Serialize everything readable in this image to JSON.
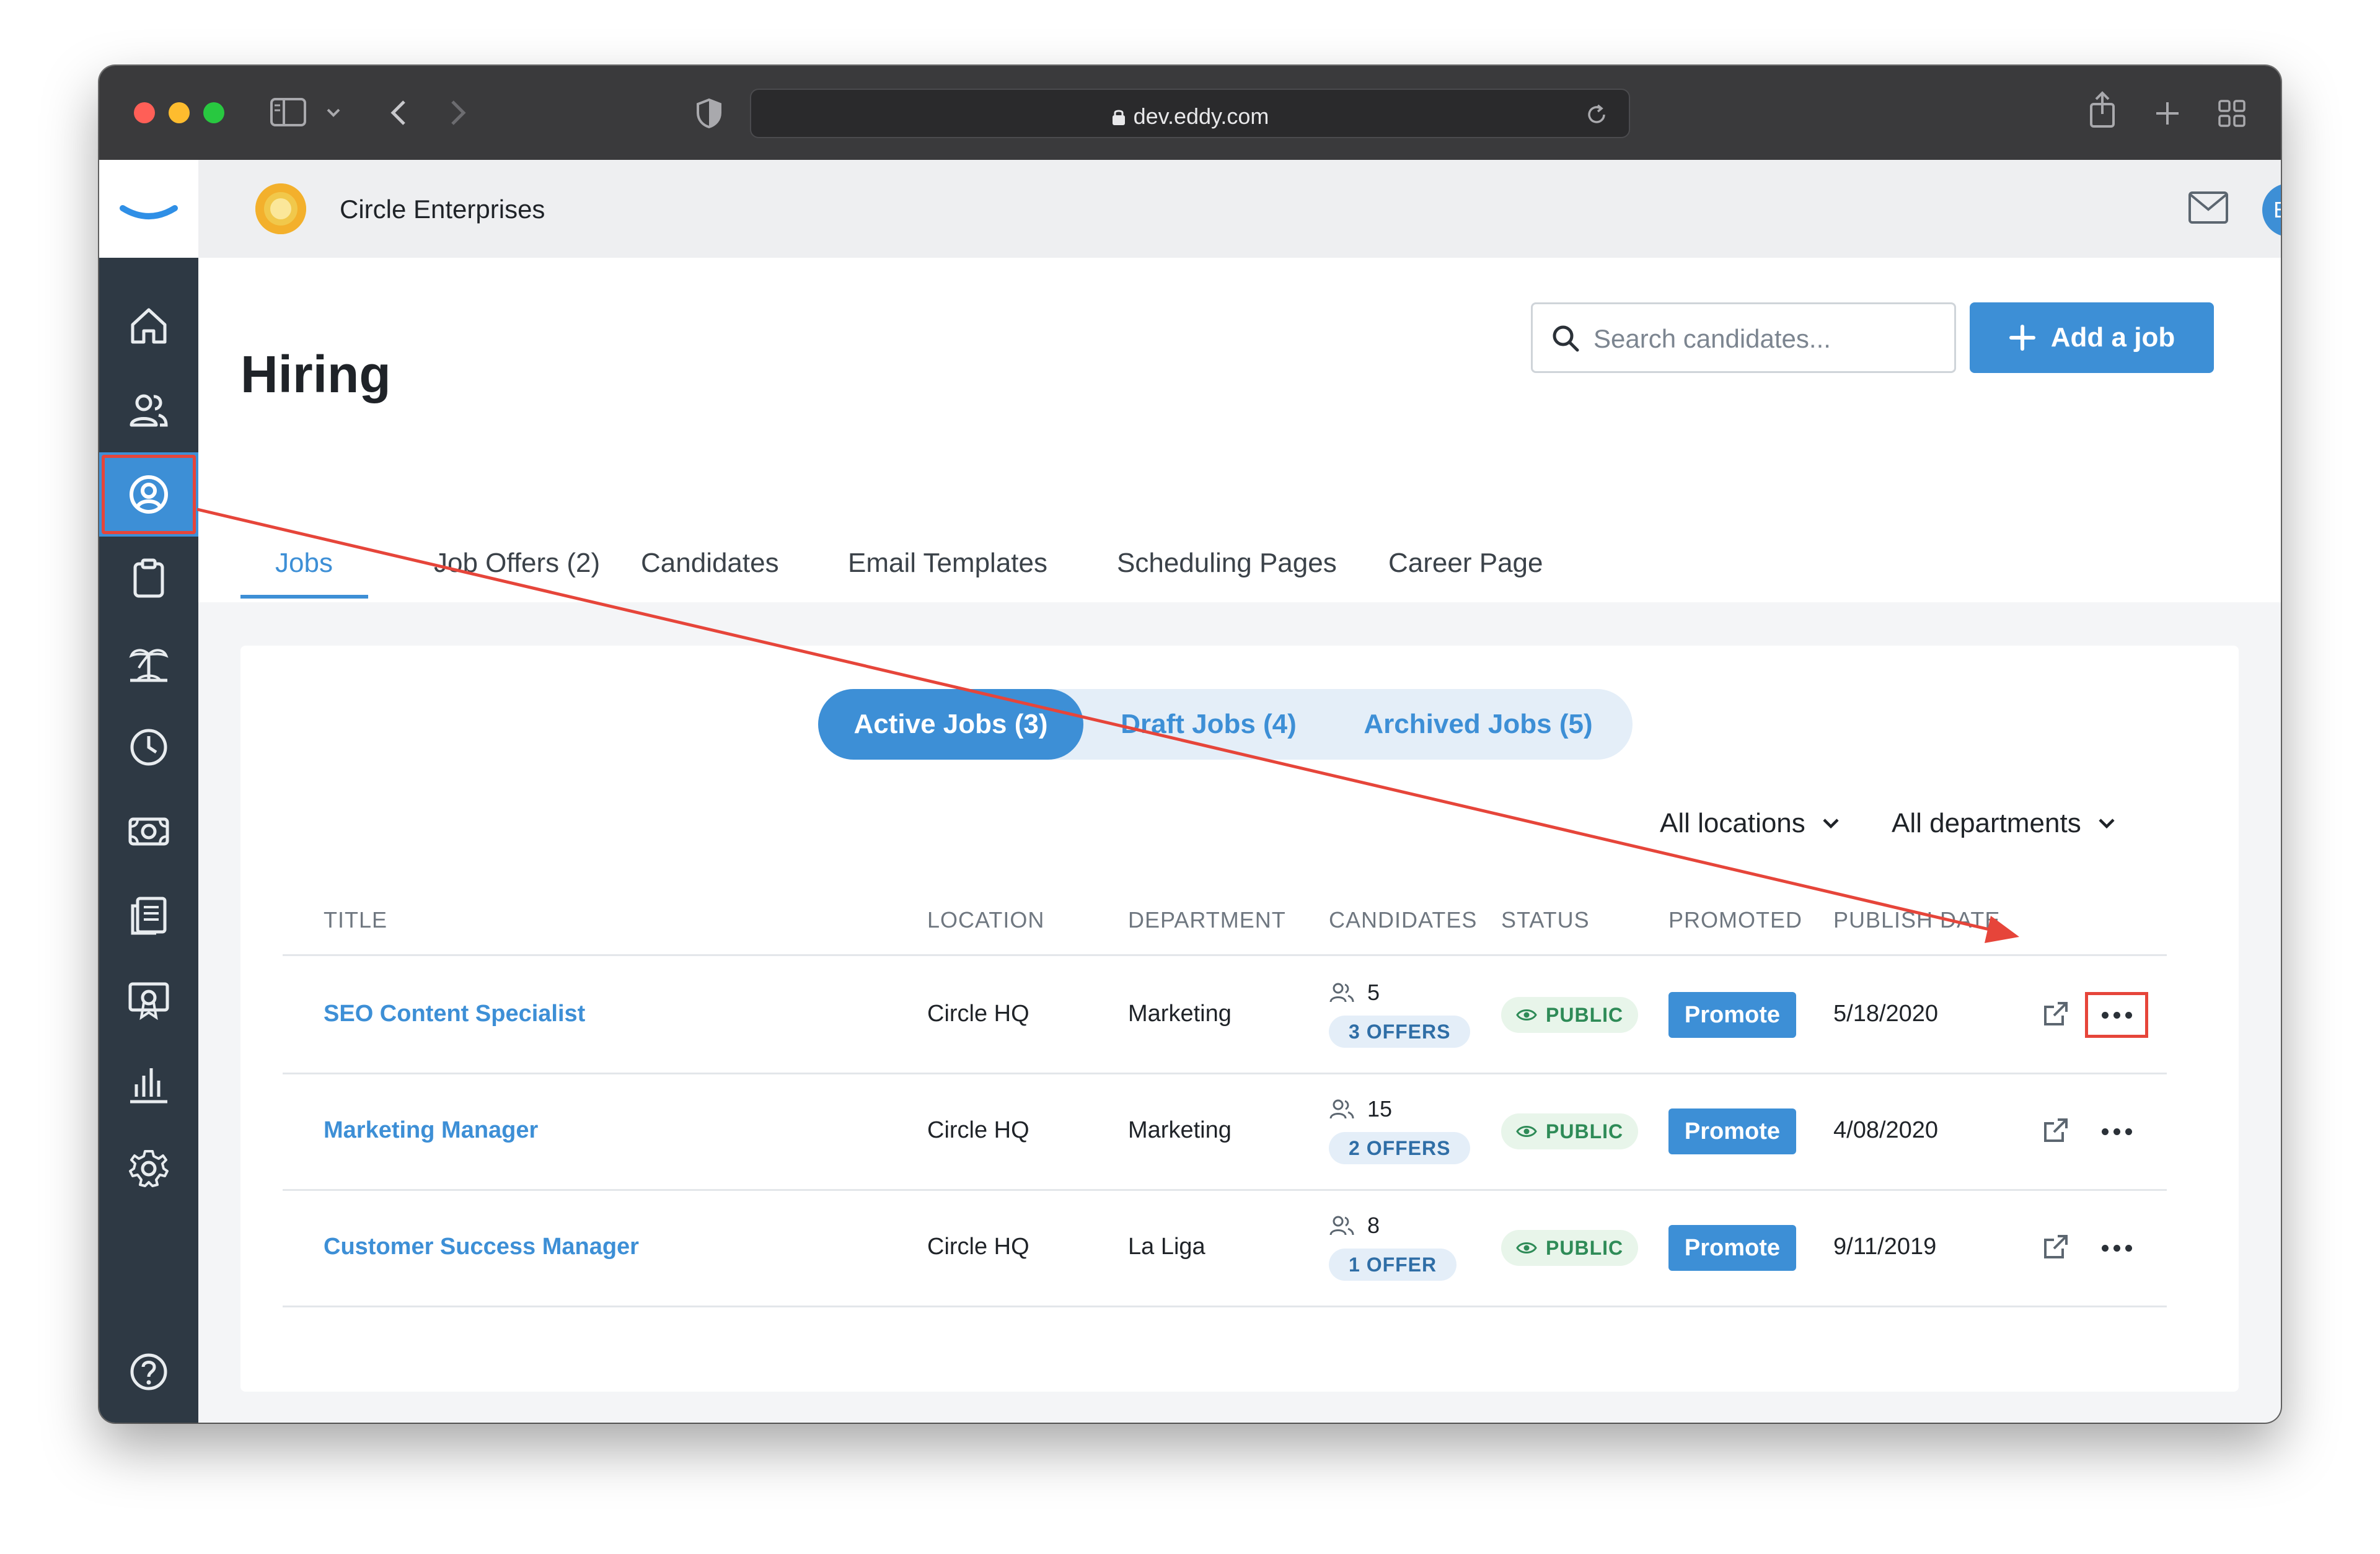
{
  "browser": {
    "url": "dev.eddy.com"
  },
  "header": {
    "company_name": "Circle Enterprises",
    "avatar_initials": "EN"
  },
  "page": {
    "title": "Hiring",
    "search_placeholder": "Search candidates...",
    "add_job_label": "Add a job"
  },
  "tabs": [
    {
      "label": "Jobs",
      "active": true
    },
    {
      "label": "Job Offers (2)",
      "active": false
    },
    {
      "label": "Candidates",
      "active": false
    },
    {
      "label": "Email Templates",
      "active": false
    },
    {
      "label": "Scheduling Pages",
      "active": false
    },
    {
      "label": "Career Page",
      "active": false
    }
  ],
  "job_filters": {
    "segments": [
      {
        "label": "Active Jobs (3)",
        "active": true
      },
      {
        "label": "Draft Jobs (4)",
        "active": false
      },
      {
        "label": "Archived Jobs (5)",
        "active": false
      }
    ],
    "location": "All locations",
    "department": "All departments"
  },
  "table": {
    "columns": [
      "TITLE",
      "LOCATION",
      "DEPARTMENT",
      "CANDIDATES",
      "STATUS",
      "PROMOTED",
      "PUBLISH DATE"
    ],
    "rows": [
      {
        "title": "SEO Content Specialist",
        "location": "Circle HQ",
        "department": "Marketing",
        "candidates": "5",
        "offers": "3 OFFERS",
        "status": "PUBLIC",
        "promote": "Promote",
        "date": "5/18/2020"
      },
      {
        "title": "Marketing Manager",
        "location": "Circle HQ",
        "department": "Marketing",
        "candidates": "15",
        "offers": "2 OFFERS",
        "status": "PUBLIC",
        "promote": "Promote",
        "date": "4/08/2020"
      },
      {
        "title": "Customer Success Manager",
        "location": "Circle HQ",
        "department": "La Liga",
        "candidates": "8",
        "offers": "1 OFFER",
        "status": "PUBLIC",
        "promote": "Promote",
        "date": "9/11/2019"
      }
    ]
  },
  "sidebar_icons": [
    "home-icon",
    "people-icon",
    "hiring-icon",
    "clipboard-icon",
    "vacation-icon",
    "clock-icon",
    "money-icon",
    "document-icon",
    "certificate-icon",
    "chart-icon",
    "settings-icon",
    "help-icon"
  ],
  "colors": {
    "accent": "#3d8fd6",
    "sidebar": "#2e3944",
    "annotation": "#e6453a",
    "public_green": "#2e8b57"
  }
}
